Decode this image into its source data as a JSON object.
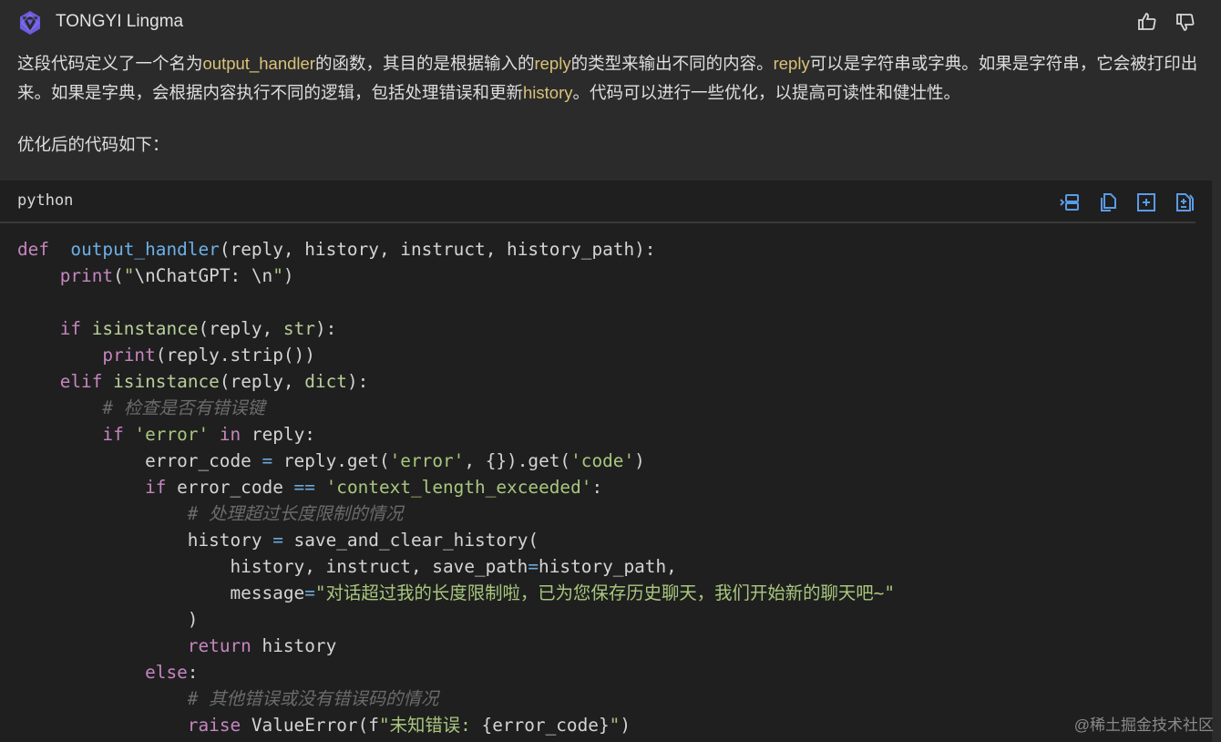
{
  "header": {
    "title": "TONGYI Lingma",
    "logo_icon": "tongyi-logo-icon",
    "like_icon": "thumbs-up-icon",
    "dislike_icon": "thumbs-down-icon"
  },
  "message": {
    "para1": [
      {
        "t": "这段代码定义了一个名为"
      },
      {
        "t": "output_handler",
        "hl": true
      },
      {
        "t": "的函数，其目的是根据输入的"
      },
      {
        "t": "reply",
        "hl": true
      },
      {
        "t": "的类型来输出不同的内容。"
      },
      {
        "t": "reply",
        "hl": true
      },
      {
        "t": "可以是字符串或字典。如果是字符串，它会被打印出来。如果是字典，会根据内容执行不同的逻辑，包括处理错误和更新"
      },
      {
        "t": "history",
        "hl": true
      },
      {
        "t": "。代码可以进行一些优化，以提高可读性和健壮性。"
      }
    ],
    "para2": "优化后的代码如下："
  },
  "code_block": {
    "language": "python",
    "tools": [
      "insert-at-cursor-icon",
      "copy-icon",
      "new-file-icon",
      "apply-diff-icon"
    ],
    "lines": [
      [
        [
          "kw",
          "def"
        ],
        [
          "",
          "  "
        ],
        [
          "fn",
          "output_handler"
        ],
        [
          "",
          "(reply, history, instruct, history_path):"
        ]
      ],
      [
        [
          "",
          "    "
        ],
        [
          "kw",
          "print"
        ],
        [
          "",
          "("
        ],
        [
          "str",
          "\""
        ],
        [
          "esc",
          "\\nChatGPT: \\n"
        ],
        [
          "str",
          "\""
        ],
        [
          "",
          ")"
        ]
      ],
      [
        [
          "",
          ""
        ]
      ],
      [
        [
          "",
          "    "
        ],
        [
          "kw",
          "if"
        ],
        [
          "",
          " "
        ],
        [
          "bi",
          "isinstance"
        ],
        [
          "",
          "(reply, "
        ],
        [
          "bi",
          "str"
        ],
        [
          "",
          "):"
        ]
      ],
      [
        [
          "",
          "        "
        ],
        [
          "kw",
          "print"
        ],
        [
          "",
          "(reply.strip())"
        ]
      ],
      [
        [
          "",
          "    "
        ],
        [
          "kw",
          "elif"
        ],
        [
          "",
          " "
        ],
        [
          "bi",
          "isinstance"
        ],
        [
          "",
          "(reply, "
        ],
        [
          "bi",
          "dict"
        ],
        [
          "",
          "):"
        ]
      ],
      [
        [
          "",
          "        "
        ],
        [
          "cm",
          "# 检查是否有错误键"
        ]
      ],
      [
        [
          "",
          "        "
        ],
        [
          "kw",
          "if"
        ],
        [
          "",
          " "
        ],
        [
          "str",
          "'error'"
        ],
        [
          "",
          " "
        ],
        [
          "kw",
          "in"
        ],
        [
          "",
          " reply:"
        ]
      ],
      [
        [
          "",
          "            error_code "
        ],
        [
          "op",
          "="
        ],
        [
          "",
          " reply.get("
        ],
        [
          "str",
          "'error'"
        ],
        [
          "",
          ", {}).get("
        ],
        [
          "str",
          "'code'"
        ],
        [
          "",
          ")"
        ]
      ],
      [
        [
          "",
          "            "
        ],
        [
          "kw",
          "if"
        ],
        [
          "",
          " error_code "
        ],
        [
          "op",
          "=="
        ],
        [
          "",
          " "
        ],
        [
          "str",
          "'context_length_exceeded'"
        ],
        [
          "",
          ":"
        ]
      ],
      [
        [
          "",
          "                "
        ],
        [
          "cm",
          "# 处理超过长度限制的情况"
        ]
      ],
      [
        [
          "",
          "                history "
        ],
        [
          "op",
          "="
        ],
        [
          "",
          " save_and_clear_history("
        ]
      ],
      [
        [
          "",
          "                    history, instruct, save_path"
        ],
        [
          "op",
          "="
        ],
        [
          "",
          "history_path,"
        ]
      ],
      [
        [
          "",
          "                    message"
        ],
        [
          "op",
          "="
        ],
        [
          "str",
          "\"对话超过我的长度限制啦，已为您保存历史聊天，我们开始新的聊天吧~\""
        ]
      ],
      [
        [
          "",
          "                )"
        ]
      ],
      [
        [
          "",
          "                "
        ],
        [
          "kw",
          "return"
        ],
        [
          "",
          " history"
        ]
      ],
      [
        [
          "",
          "            "
        ],
        [
          "kw",
          "else"
        ],
        [
          "",
          ":"
        ]
      ],
      [
        [
          "",
          "                "
        ],
        [
          "cm",
          "# 其他错误或没有错误码的情况"
        ]
      ],
      [
        [
          "",
          "                "
        ],
        [
          "kw",
          "raise"
        ],
        [
          "",
          " ValueError(f"
        ],
        [
          "str",
          "\"未知错误: "
        ],
        [
          "",
          "{error_code}"
        ],
        [
          "str",
          "\""
        ],
        [
          "",
          ")"
        ]
      ]
    ]
  },
  "watermark": "@稀土掘金技术社区"
}
